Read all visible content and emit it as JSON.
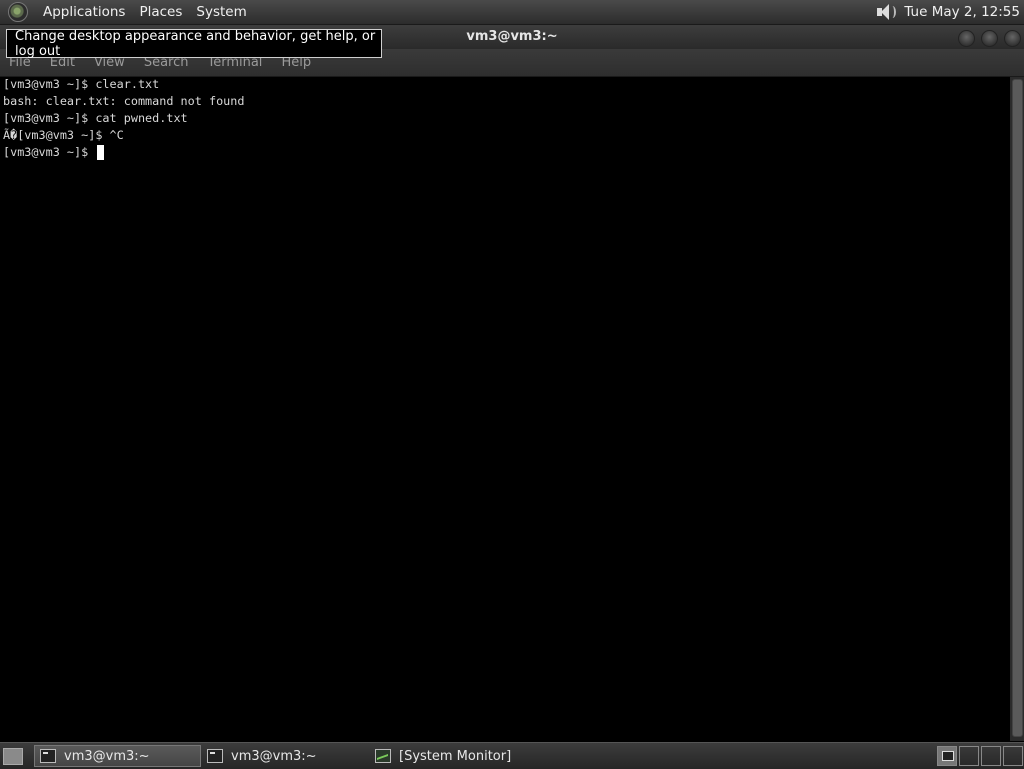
{
  "top_panel": {
    "menus": [
      "Applications",
      "Places",
      "System"
    ],
    "clock": "Tue May  2, 12:55"
  },
  "tooltip": "Change desktop appearance and behavior, get help, or log out",
  "window": {
    "title": "vm3@vm3:~",
    "menu": [
      "File",
      "Edit",
      "View",
      "Search",
      "Terminal",
      "Help"
    ]
  },
  "terminal": {
    "lines": [
      "[vm3@vm3 ~]$ clear.txt",
      "bash: clear.txt: command not found",
      "[vm3@vm3 ~]$ cat pwned.txt",
      "Ã�[vm3@vm3 ~]$ ^C",
      "[vm3@vm3 ~]$ "
    ]
  },
  "taskbar": {
    "tasks": [
      {
        "label": "vm3@vm3:~",
        "icon": "terminal-icon",
        "active": true
      },
      {
        "label": "vm3@vm3:~",
        "icon": "terminal-icon",
        "active": false
      },
      {
        "label": "[System Monitor]",
        "icon": "system-monitor-icon",
        "active": false
      }
    ]
  }
}
